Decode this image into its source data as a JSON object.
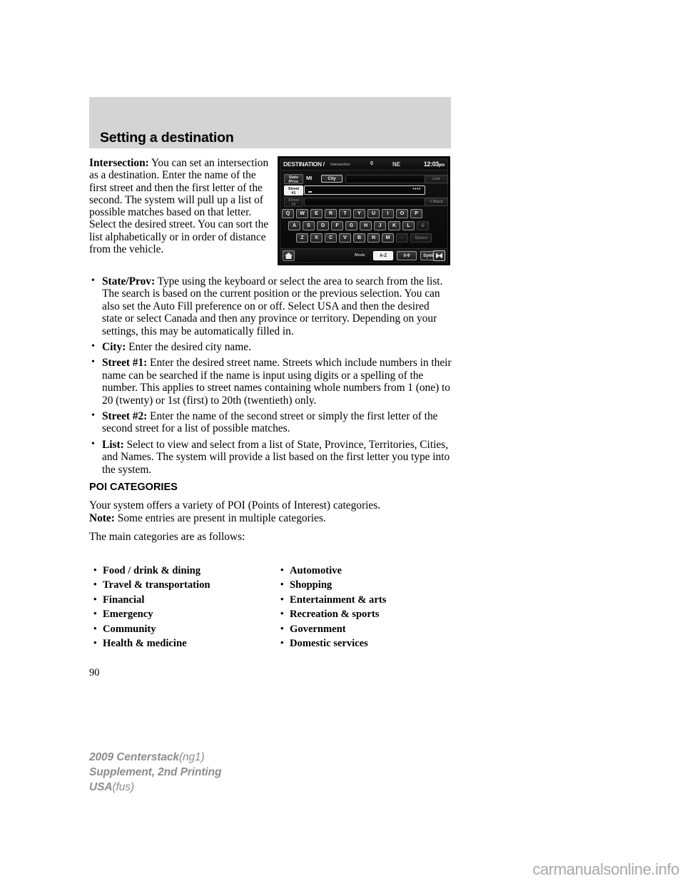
{
  "chapter": {
    "title": "Setting a destination"
  },
  "intro": {
    "term": "Intersection:",
    "body": "You can set an intersection as a destination. Enter the name of the first street and then the first letter of the second. The system will pull up a list of possible matches based on that letter. Select the desired street. You can sort the list alphabetically or in order of distance from the vehicle."
  },
  "nav_screen": {
    "title": "DESTINATION /",
    "subtitle": "Intersection",
    "distance": "0",
    "compass": "NE",
    "clock_time": "12:03",
    "clock_ampm": "pm",
    "state_prov_label": "State\n/Prov.",
    "state_prov_line1": "State",
    "state_prov_line2": "/Prov.",
    "state_value": "MI",
    "city_button": "City",
    "list_button": "List",
    "street1_line1": "Street",
    "street1_line2": "#1",
    "street1_dots": "••••",
    "street2_line1": "Street",
    "street2_line2": "#2",
    "back_button": "< Back",
    "keyboard_row1": [
      "Q",
      "W",
      "E",
      "R",
      "T",
      "Y",
      "U",
      "I",
      "O",
      "P"
    ],
    "keyboard_row2": [
      "A",
      "S",
      "D",
      "F",
      "G",
      "H",
      "J",
      "K",
      "L"
    ],
    "keyboard_row2_extra": "&",
    "keyboard_row3": [
      "Z",
      "X",
      "C",
      "V",
      "B",
      "N",
      "M"
    ],
    "keyboard_row3_dash": "-",
    "keyboard_row3_space": "Space",
    "mode_label": "Mode",
    "mode_az": "A-Z",
    "mode_09": "0-9",
    "mode_symbol": "Symbol",
    "home_icon": "home-icon",
    "close_icon": "close-icon"
  },
  "bullets": [
    {
      "term": "State/Prov:",
      "text": " Type using the keyboard or select the area to search from the list. The search is based on the current position or the previous selection. You can also set the Auto Fill preference on or off. Select USA and then the desired state or select Canada and then any province or territory. Depending on your settings, this may be automatically filled in."
    },
    {
      "term": "City:",
      "text": " Enter the desired city name."
    },
    {
      "term": "Street #1:",
      "text": " Enter the desired street name. Streets which include numbers in their name can be searched if the name is input using digits or a spelling of the number. This applies to street names containing whole numbers from 1 (one) to 20 (twenty) or 1st (first) to 20th (twentieth) only."
    },
    {
      "term": "Street #2:",
      "text": " Enter the name of the second street or simply the first letter of the second street for a list of possible matches."
    },
    {
      "term": "List:",
      "text": " Select to view and select from a list of State, Province, Territories, Cities, and Names. The system will provide a list based on the first letter you type into the system."
    }
  ],
  "poi": {
    "heading": "POI CATEGORIES",
    "intro": "Your system offers a variety of POI (Points of Interest) categories.",
    "note_term": "Note:",
    "note_text": " Some entries are present in multiple categories.",
    "lead_in": "The main categories are as follows:",
    "categories_left": [
      "Food / drink & dining",
      "Travel & transportation",
      "Financial",
      "Emergency",
      "Community",
      "Health & medicine"
    ],
    "categories_right": [
      "Automotive",
      "Shopping",
      "Entertainment & arts",
      "Recreation & sports",
      "Government",
      "Domestic services"
    ]
  },
  "page_number": "90",
  "footer": {
    "line1_bold": "2009 Centerstack",
    "line1_light": "(ng1)",
    "line2_bold": "Supplement, 2nd Printing",
    "line3_bold": "USA",
    "line3_light": "(fus)"
  },
  "watermark": "carmanualsonline.info",
  "colors": {
    "band": "#d4d4d4",
    "footer_gray": "#8d8d8d",
    "watermark_gray": "#a8a8a8"
  }
}
